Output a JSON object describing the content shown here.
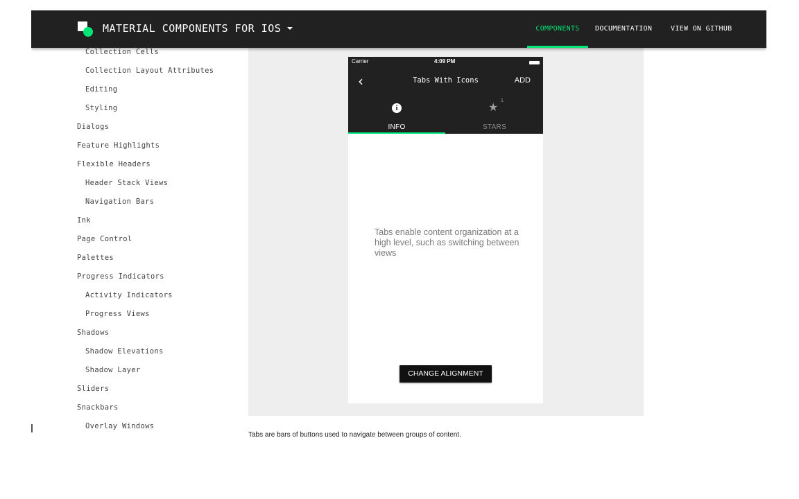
{
  "header": {
    "brand": "MATERIAL COMPONENTS FOR IOS",
    "nav": [
      {
        "label": "COMPONENTS",
        "active": true
      },
      {
        "label": "DOCUMENTATION",
        "active": false
      },
      {
        "label": "VIEW ON GITHUB",
        "active": false
      }
    ],
    "accent_color": "#00e676",
    "background_color": "#212121"
  },
  "sidebar": {
    "items": [
      {
        "label": "Collection Cells",
        "level": 1
      },
      {
        "label": "Collection Layout Attributes",
        "level": 1
      },
      {
        "label": "Editing",
        "level": 1
      },
      {
        "label": "Styling",
        "level": 1
      },
      {
        "label": "Dialogs",
        "level": 0
      },
      {
        "label": "Feature Highlights",
        "level": 0
      },
      {
        "label": "Flexible Headers",
        "level": 0
      },
      {
        "label": "Header Stack Views",
        "level": 1
      },
      {
        "label": "Navigation Bars",
        "level": 1
      },
      {
        "label": "Ink",
        "level": 0
      },
      {
        "label": "Page Control",
        "level": 0
      },
      {
        "label": "Palettes",
        "level": 0
      },
      {
        "label": "Progress Indicators",
        "level": 0
      },
      {
        "label": "Activity Indicators",
        "level": 1
      },
      {
        "label": "Progress Views",
        "level": 1
      },
      {
        "label": "Shadows",
        "level": 0
      },
      {
        "label": "Shadow Elevations",
        "level": 1
      },
      {
        "label": "Shadow Layer",
        "level": 1
      },
      {
        "label": "Sliders",
        "level": 0
      },
      {
        "label": "Snackbars",
        "level": 0
      },
      {
        "label": "Overlay Windows",
        "level": 1
      }
    ]
  },
  "phone": {
    "status": {
      "carrier": "Carrier",
      "time": "4:09 PM"
    },
    "title": "Tabs With Icons",
    "action": "ADD",
    "tabs": [
      {
        "label": "INFO",
        "icon": "info-icon",
        "active": true
      },
      {
        "label": "STARS",
        "icon": "star-icon",
        "badge": "1",
        "active": false
      }
    ],
    "content": "Tabs enable content organization at a high level, such as switching between views",
    "button": "CHANGE ALIGNMENT"
  },
  "caption": "Tabs are bars of buttons used to navigate between groups of content."
}
